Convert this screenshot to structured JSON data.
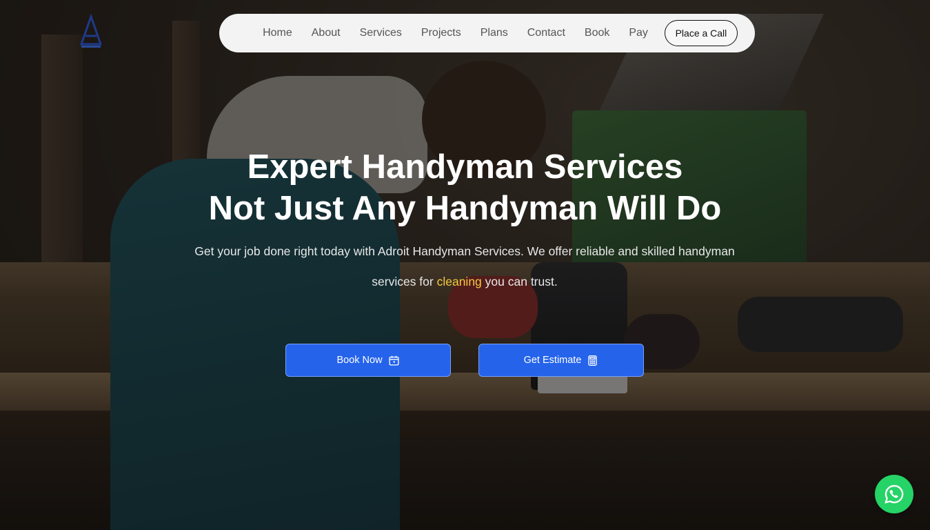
{
  "nav": {
    "items": [
      {
        "label": "Home"
      },
      {
        "label": "About"
      },
      {
        "label": "Services"
      },
      {
        "label": "Projects"
      },
      {
        "label": "Plans"
      },
      {
        "label": "Contact"
      },
      {
        "label": "Book"
      },
      {
        "label": "Pay"
      }
    ],
    "call_label": "Place a Call"
  },
  "hero": {
    "title_line1": "Expert Handyman Services",
    "title_line2": "Not Just Any Handyman Will Do",
    "subtitle_part1": "Get your job done right today with Adroit Handyman Services. We offer reliable and skilled handyman services for ",
    "highlight_word": "cleaning",
    "subtitle_part2": " you can trust.",
    "book_label": "Book Now",
    "estimate_label": "Get Estimate"
  },
  "colors": {
    "accent": "#2563eb",
    "highlight": "#f5c842",
    "whatsapp": "#25d366"
  },
  "icons": {
    "logo": "logo-icon",
    "book": "calendar-icon",
    "estimate": "calculator-icon",
    "chat": "whatsapp-icon"
  }
}
